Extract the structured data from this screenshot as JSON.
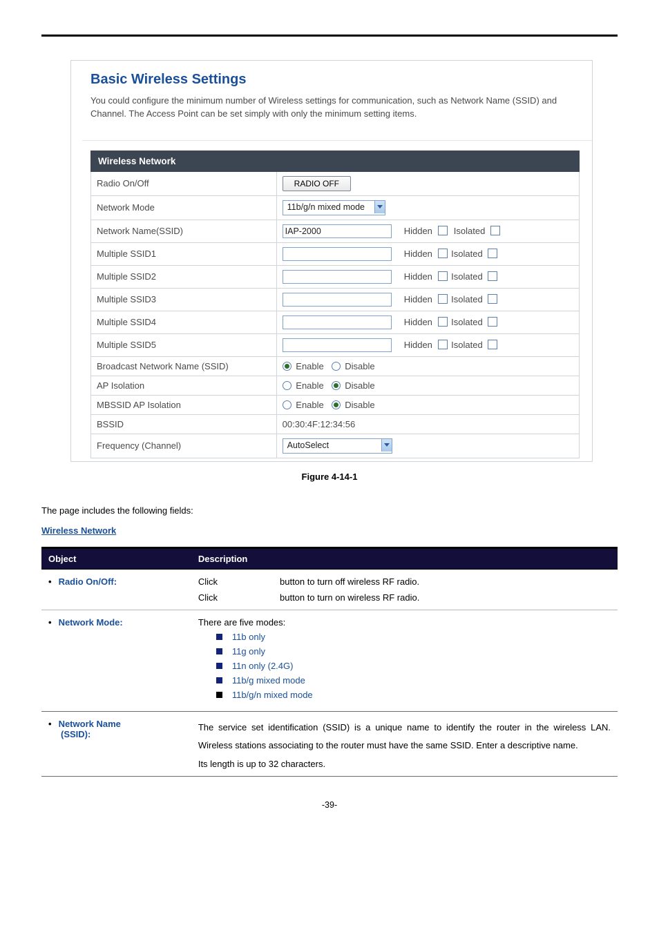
{
  "panel": {
    "title": "Basic Wireless Settings",
    "description": "You could configure the minimum number of Wireless settings for communication, such as Network Name (SSID) and Channel. The Access Point can be set simply with only the minimum setting items.",
    "section_header": "Wireless Network",
    "rows": {
      "radio": {
        "label": "Radio On/Off",
        "button": "RADIO OFF"
      },
      "mode": {
        "label": "Network Mode",
        "value": "11b/g/n mixed mode"
      },
      "ssid": {
        "label": "Network Name(SSID)",
        "value": "IAP-2000",
        "hidden_label": "Hidden",
        "isolated_label": "Isolated"
      },
      "mssid1": {
        "label": "Multiple SSID1",
        "hidden_label": "Hidden",
        "isolated_label": "Isolated"
      },
      "mssid2": {
        "label": "Multiple SSID2",
        "hidden_label": "Hidden",
        "isolated_label": "Isolated"
      },
      "mssid3": {
        "label": "Multiple SSID3",
        "hidden_label": "Hidden",
        "isolated_label": "Isolated"
      },
      "mssid4": {
        "label": "Multiple SSID4",
        "hidden_label": "Hidden",
        "isolated_label": "Isolated"
      },
      "mssid5": {
        "label": "Multiple SSID5",
        "hidden_label": "Hidden",
        "isolated_label": "Isolated"
      },
      "broadcast": {
        "label": "Broadcast Network Name (SSID)",
        "enable": "Enable",
        "disable": "Disable"
      },
      "apiso": {
        "label": "AP Isolation",
        "enable": "Enable",
        "disable": "Disable"
      },
      "mbssidiso": {
        "label": "MBSSID AP Isolation",
        "enable": "Enable",
        "disable": "Disable"
      },
      "bssid": {
        "label": "BSSID",
        "value": "00:30:4F:12:34:56"
      },
      "freq": {
        "label": "Frequency (Channel)",
        "value": "AutoSelect"
      }
    }
  },
  "figure_caption": "Figure 4-14-1",
  "intro_line": "The page includes the following fields:",
  "section_link": "Wireless Network",
  "table": {
    "head": {
      "object": "Object",
      "description": "Description"
    },
    "radio": {
      "name": "Radio On/Off:",
      "l1a": "Click",
      "l1b": "button to turn off wireless RF radio.",
      "l2a": "Click",
      "l2b": "button to turn on wireless RF radio."
    },
    "mode": {
      "name": "Network Mode:",
      "intro": "There are five modes:",
      "m1": "11b only",
      "m2": "11g only",
      "m3": "11n only (2.4G)",
      "m4": "11b/g mixed mode",
      "m5": "11b/g/n mixed mode"
    },
    "ssid": {
      "name1": "Network Name",
      "name2": "(SSID):",
      "p1": "The service set identification (SSID) is a unique name to identify the router in the wireless LAN. Wireless stations associating to the router must have the same SSID. Enter a descriptive name.",
      "p2": "Its length is up to 32 characters."
    }
  },
  "page_number": "-39-"
}
